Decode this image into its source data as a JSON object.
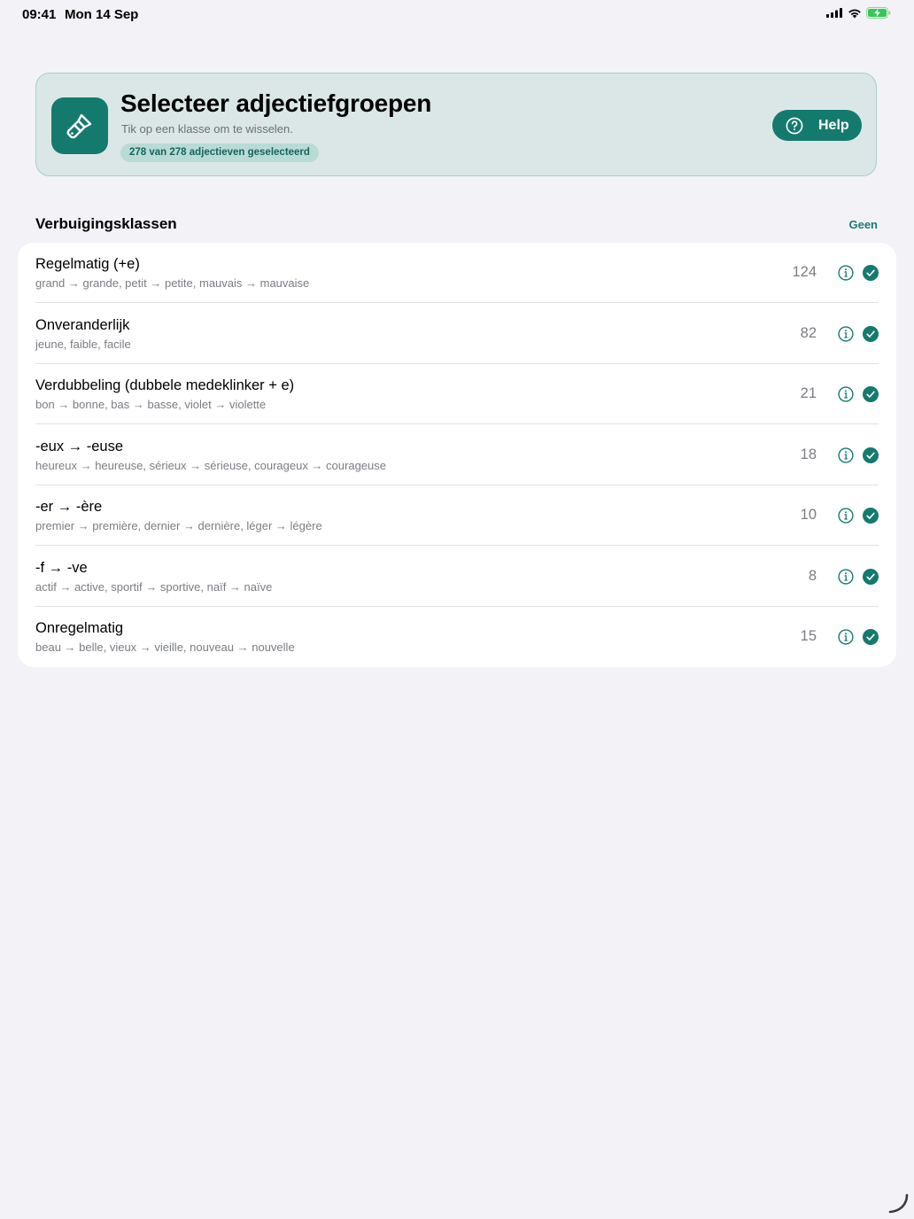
{
  "status_bar": {
    "time": "09:41",
    "date": "Mon 14 Sep"
  },
  "header": {
    "title": "Selecteer adjectiefgroepen",
    "subtitle": "Tik op een klasse om te wisselen.",
    "badge": "278 van 278 adjectieven geselecteerd",
    "help_label": "Help",
    "app_icon": "paintbrush-icon"
  },
  "section": {
    "title": "Verbuigingsklassen",
    "action_label": "Geen"
  },
  "colors": {
    "accent": "#157a6e",
    "header_bg": "#dbe7e7",
    "badge_bg": "#b9dbd5"
  },
  "rows": [
    {
      "title": "Regelmatig (+e)",
      "example": "grand → grande, petit → petite, mauvais → mauvaise",
      "count": "124",
      "selected": true
    },
    {
      "title": "Onveranderlijk",
      "example": "jeune, faible, facile",
      "count": "82",
      "selected": true
    },
    {
      "title": "Verdubbeling (dubbele medeklinker + e)",
      "example": "bon → bonne, bas → basse, violet → violette",
      "count": "21",
      "selected": true
    },
    {
      "title": "-eux → -euse",
      "example": "heureux → heureuse, sérieux → sérieuse, courageux → courageuse",
      "count": "18",
      "selected": true
    },
    {
      "title": "-er → -ère",
      "example": "premier → première, dernier → dernière, léger → légère",
      "count": "10",
      "selected": true
    },
    {
      "title": "-f → -ve",
      "example": "actif → active, sportif → sportive, naïf → naïve",
      "count": "8",
      "selected": true
    },
    {
      "title": "Onregelmatig",
      "example": "beau → belle, vieux → vieille, nouveau → nouvelle",
      "count": "15",
      "selected": true
    }
  ]
}
